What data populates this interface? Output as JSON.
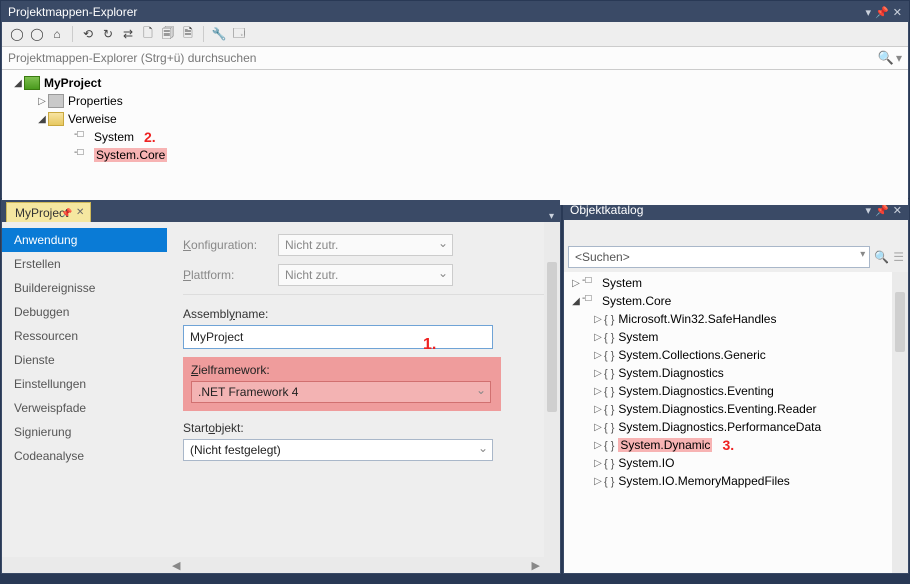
{
  "explorer": {
    "title": "Projektmappen-Explorer",
    "search_placeholder": "Projektmappen-Explorer (Strg+ü) durchsuchen",
    "tree": {
      "project": "MyProject",
      "properties": "Properties",
      "references": "Verweise",
      "ref_items": [
        "System",
        "System.Core"
      ]
    },
    "annotation": "2."
  },
  "tab_label": "MyProject",
  "categories": [
    "Anwendung",
    "Erstellen",
    "Buildereignisse",
    "Debuggen",
    "Ressourcen",
    "Dienste",
    "Einstellungen",
    "Verweispfade",
    "Signierung",
    "Codeanalyse"
  ],
  "props": {
    "konfiguration_label": "Konfiguration:",
    "konfiguration_val": "Nicht zutr.",
    "plattform_label": "Plattform:",
    "plattform_val": "Nicht zutr.",
    "assembly_label": "Assemblyname:",
    "assembly_val": "MyProject",
    "zielframework_label": "Zielframework:",
    "zielframework_val": ".NET Framework 4",
    "startobjekt_label": "Startobjekt:",
    "startobjekt_val": "(Nicht festgelegt)",
    "annotation": "1."
  },
  "catalog": {
    "title": "Objektkatalog",
    "search_placeholder": "<Suchen>",
    "root_system": "System",
    "root_core": "System.Core",
    "ns": [
      "Microsoft.Win32.SafeHandles",
      "System",
      "System.Collections.Generic",
      "System.Diagnostics",
      "System.Diagnostics.Eventing",
      "System.Diagnostics.Eventing.Reader",
      "System.Diagnostics.PerformanceData",
      "System.Dynamic",
      "System.IO",
      "System.IO.MemoryMappedFiles"
    ],
    "annotation": "3."
  }
}
